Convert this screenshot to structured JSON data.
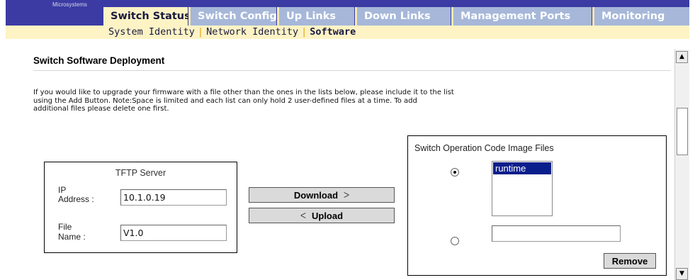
{
  "header": {
    "brand": "Microsystems",
    "tabs": [
      {
        "label": "Switch Status",
        "active": true
      },
      {
        "label": "Switch Config",
        "active": false
      },
      {
        "label": "Up Links",
        "active": false
      },
      {
        "label": "Down Links",
        "active": false
      },
      {
        "label": "Management Ports",
        "active": false
      },
      {
        "label": "Monitoring",
        "active": false
      }
    ],
    "subnav": [
      {
        "label": "System Identity",
        "active": false
      },
      {
        "label": "Network Identity",
        "active": false
      },
      {
        "label": "Software",
        "active": true
      }
    ]
  },
  "page": {
    "title": "Switch Software Deployment",
    "intro_lines": [
      "If you would like to upgrade your firmware with a file other than the ones in the lists below, please include it to the list",
      "using the Add Button. Note:Space is limited and each list can only hold 2 user-defined files at a time. To add",
      "additional files please delete one first."
    ]
  },
  "tftp": {
    "title": "TFTP Server",
    "ip_label_line1": "IP",
    "ip_label_line2": "Address :",
    "ip_value": "10.1.0.19",
    "file_label_line1": "File",
    "file_label_line2": "Name  :",
    "file_value": "V1.0"
  },
  "actions": {
    "download_label": "Download",
    "upload_label": "Upload"
  },
  "image_files": {
    "title": "Switch Operation Code Image Files",
    "list_items": [
      "runtime"
    ],
    "custom_file_value": "",
    "remove_label": "Remove",
    "selected_option": "list"
  },
  "icons": {
    "download_arrow": "chevron-right-icon",
    "upload_arrow": "chevron-left-icon",
    "scroll_up": "triangle-up-icon",
    "scroll_down": "triangle-down-icon"
  }
}
